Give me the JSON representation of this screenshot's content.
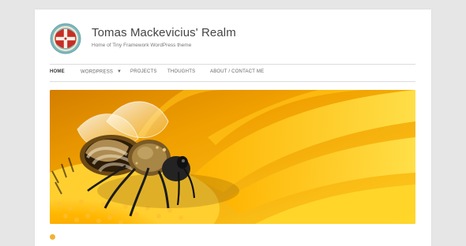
{
  "site": {
    "title": "Tomas Mackevicius' Realm",
    "description": "Home of Tiny Framework WordPress theme"
  },
  "nav": {
    "items": [
      {
        "label": "HOME",
        "active": true
      },
      {
        "label": "WORDPRESS",
        "has_dropdown": true
      },
      {
        "label": "PROJECTS"
      },
      {
        "label": "THOUGHTS"
      },
      {
        "label": "ABOUT / CONTACT ME"
      }
    ]
  },
  "hero": {
    "image": "bee-on-yellow-flower"
  },
  "colors": {
    "page_background": "#e6e6e6",
    "content_background": "#ffffff",
    "title_color": "#444444",
    "nav_border": "#dcdcdc",
    "hero_orange": "#f4a400",
    "hero_yellow": "#ffd51a"
  },
  "icons": {
    "logo": "red-cross-emblem-icon",
    "dropdown": "chevron-down-icon",
    "bottom": "post-format-icon"
  }
}
